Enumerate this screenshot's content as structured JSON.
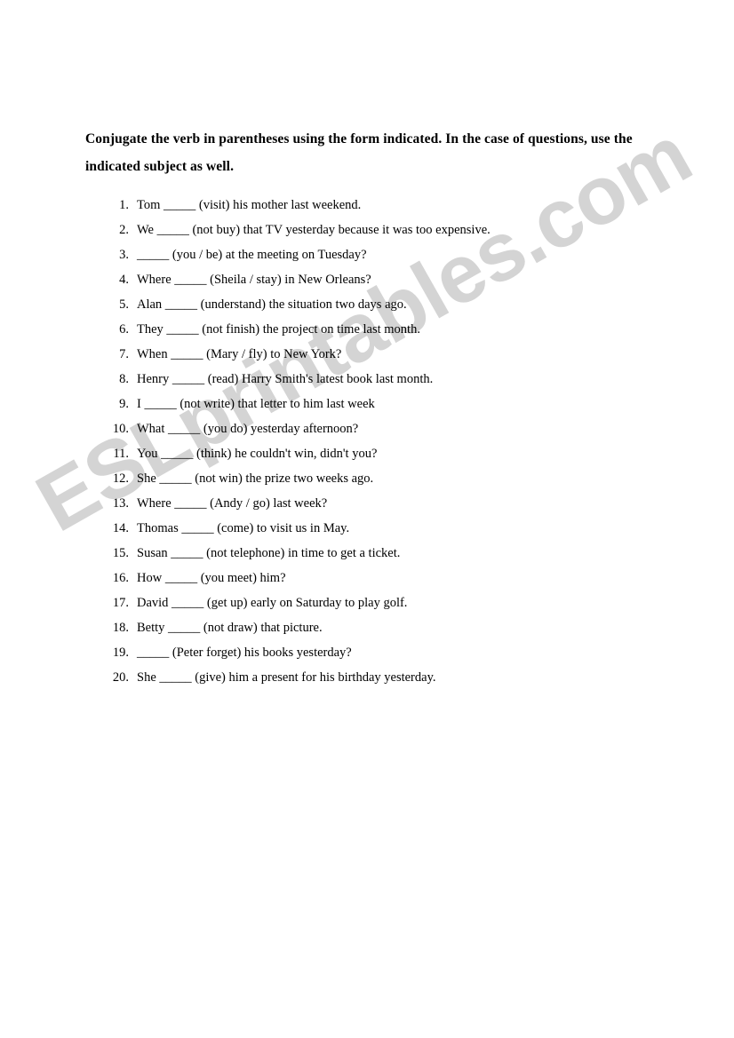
{
  "document": {
    "heading": "Conjugate the verb in parentheses using the form indicated. In the case of questions, use the indicated subject as well.",
    "watermark": "ESLprintables.com",
    "watermark_color": "#d4d4d4",
    "background_color": "#ffffff",
    "text_color": "#000000"
  },
  "exercises": [
    {
      "number": "1.",
      "text": "Tom _____ (visit) his mother last weekend."
    },
    {
      "number": "2.",
      "text": "We _____ (not buy) that TV yesterday because it was too expensive."
    },
    {
      "number": "3.",
      "text": "_____ (you / be) at the meeting on Tuesday?"
    },
    {
      "number": "4.",
      "text": "Where _____ (Sheila / stay) in New Orleans?"
    },
    {
      "number": "5.",
      "text": "Alan _____ (understand) the situation two days ago."
    },
    {
      "number": "6.",
      "text": "They _____ (not finish) the project on time last month."
    },
    {
      "number": "7.",
      "text": "When _____ (Mary / fly) to New York?"
    },
    {
      "number": "8.",
      "text": "Henry _____ (read) Harry Smith's latest book last month."
    },
    {
      "number": "9.",
      "text": "I _____ (not write) that letter to him last week"
    },
    {
      "number": "10.",
      "text": "What _____ (you do) yesterday afternoon?"
    },
    {
      "number": "11.",
      "text": "You _____ (think) he couldn't win, didn't you?"
    },
    {
      "number": "12.",
      "text": "She _____ (not win) the prize two weeks ago."
    },
    {
      "number": "13.",
      "text": "Where _____ (Andy / go) last week?"
    },
    {
      "number": "14.",
      "text": "Thomas _____ (come) to visit us in May."
    },
    {
      "number": "15.",
      "text": "Susan _____ (not telephone) in time to get a ticket."
    },
    {
      "number": "16.",
      "text": "How _____ (you meet) him?"
    },
    {
      "number": "17.",
      "text": "David _____ (get up) early on Saturday to play golf."
    },
    {
      "number": "18.",
      "text": "Betty _____ (not draw) that picture."
    },
    {
      "number": "19.",
      "text": "_____ (Peter forget) his books yesterday?"
    },
    {
      "number": "20.",
      "text": "She _____ (give) him a present for his birthday yesterday."
    }
  ]
}
